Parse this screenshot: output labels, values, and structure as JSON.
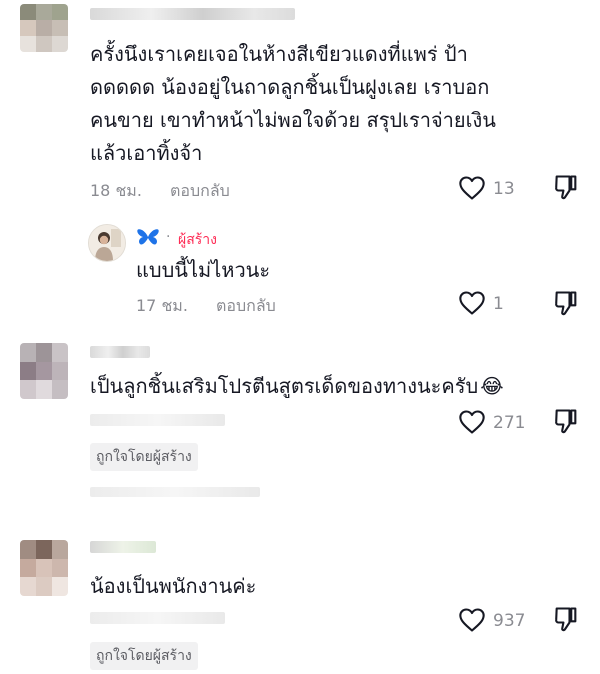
{
  "comments": [
    {
      "text": "ครั้งนึงเราเคยเจอในห้างสีเขียวแดงที่แพร่ ป้าดดดดด น้องอยู่ในถาดลูกชิ้นเป็นฝูงเลย เราบอกคนขาย เขาทำหน้าไม่พอใจด้วย สรุปเราจ่ายเงินแล้วเอาทิ้งจ้า",
      "lines": [
        "ครั้งนึงเราเคยเจอในห้างสีเขียวแดงที่แพร่ ป้า",
        "ดดดดด น้องอยู่ในถาดลูกชิ้นเป็นฝูงเลย เราบอก",
        "คนขาย เขาทำหน้าไม่พอใจด้วย สรุปเราจ่ายเงิน",
        "แล้วเอาทิ้งจ้า"
      ],
      "time": "18 ชม.",
      "reply_label": "ตอบกลับ",
      "likes": "13"
    },
    {
      "creator_label": "ผู้สร้าง",
      "text": "แบบนี้ไม่ไหวนะ",
      "time": "17 ชม.",
      "reply_label": "ตอบกลับ",
      "likes": "1"
    },
    {
      "text": "เป็นลูกชิ้นเสริมโปรตีนสูตรเด็ดของทางนะครับ",
      "emoji": "😂",
      "likes": "271",
      "liked_by_creator": "ถูกใจโดยผู้สร้าง"
    },
    {
      "text": "น้องเป็นพนักงานค่ะ",
      "likes": "937",
      "liked_by_creator": "ถูกใจโดยผู้สร้าง"
    }
  ],
  "colors": {
    "accent": "#fe2c55",
    "butterfly": "#1e73e8",
    "meta": "#8a8b91"
  }
}
